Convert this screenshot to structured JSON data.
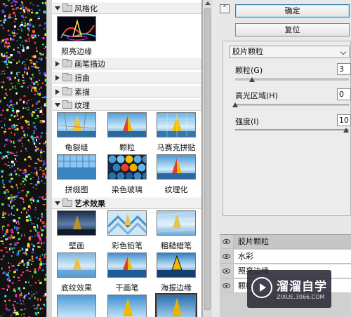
{
  "gallery": {
    "categories": [
      {
        "name": "风格化",
        "expanded": true
      },
      {
        "name": "画笔描边",
        "expanded": false
      },
      {
        "name": "扭曲",
        "expanded": false
      },
      {
        "name": "素描",
        "expanded": false
      },
      {
        "name": "纹理",
        "expanded": true
      },
      {
        "name": "艺术效果",
        "expanded": true
      }
    ],
    "stylize_thumbs": [
      "照亮边缘"
    ],
    "texture_thumbs": [
      "龟裂缝",
      "颗粒",
      "马赛克拼贴",
      "拼缀图",
      "染色玻璃",
      "纹理化"
    ],
    "artistic_thumbs": [
      "壁画",
      "彩色铅笔",
      "粗糙蜡笔",
      "底纹效果",
      "干画笔",
      "海报边缘"
    ]
  },
  "buttons": {
    "ok": "确定",
    "reset": "复位"
  },
  "filter_select": {
    "value": "胶片颗粒"
  },
  "params": [
    {
      "label": "颗粒(G)",
      "value": "3",
      "level": 0.15
    },
    {
      "label": "高光区域(H)",
      "value": "0",
      "level": 0.0
    },
    {
      "label": "强度(I)",
      "value": "10",
      "level": 1.0
    }
  ],
  "layers": [
    "胶片颗粒",
    "水彩",
    "照亮边缘",
    "颗粒"
  ],
  "watermark": {
    "title": "溜溜自学",
    "sub": "ZIXUE.3066.COM"
  }
}
